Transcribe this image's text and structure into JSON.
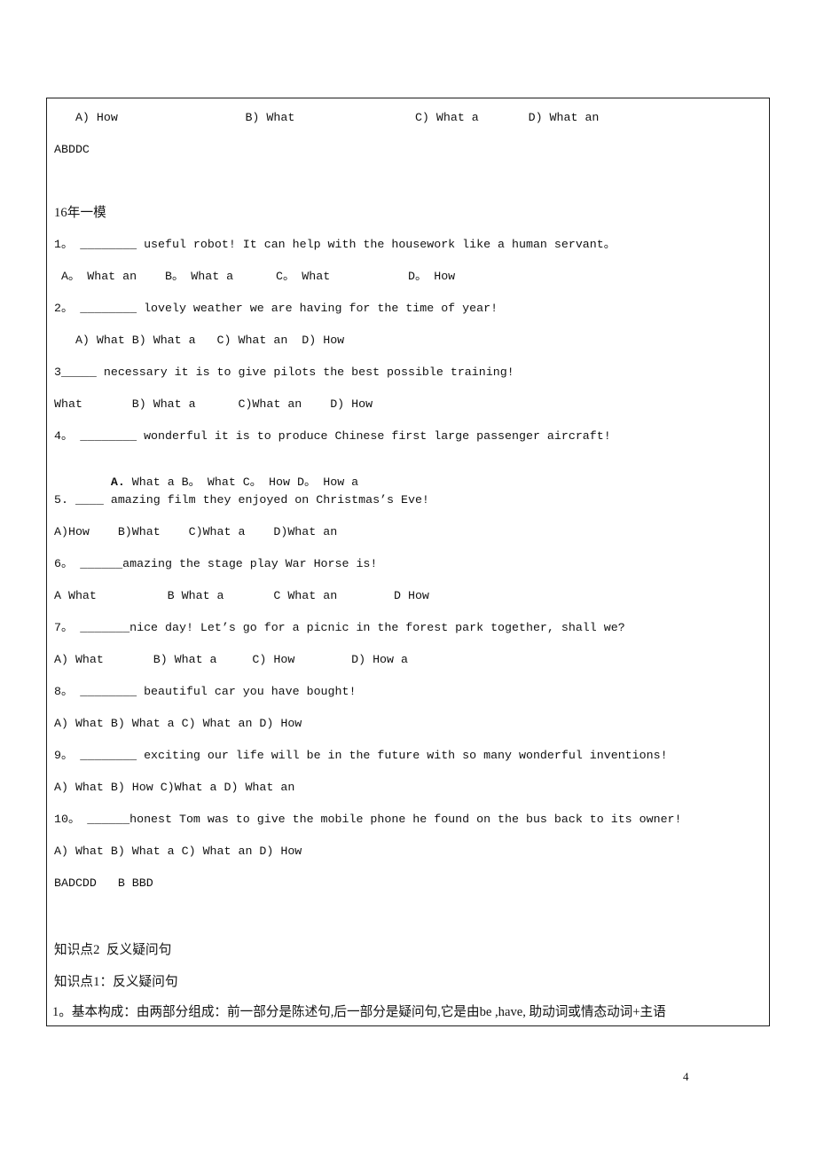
{
  "document": {
    "page_number": "4",
    "border_color": "#1d1d1d"
  },
  "exercise_box": {
    "prev_question_options": "   A) How                  B) What                 C) What a       D) What an",
    "prev_answer_key": "ABDDC",
    "section_heading": "16年一模",
    "questions": [
      {
        "id": "q1",
        "stem": "1。 ________ useful robot! It can help with the housework like a human servant。",
        "options": " A。 What an    B。 What a      C。 What           D。 How"
      },
      {
        "id": "q2",
        "stem": "2。 ________ lovely weather we are having for the time of year!",
        "options": "   A) What B) What a   C) What an  D) How"
      },
      {
        "id": "q3",
        "stem": "3_____ necessary it is to give pilots the best possible training!",
        "options": "What       B) What a      C)What an    D) How"
      },
      {
        "id": "q4",
        "stem": "4。 ________ wonderful it is to produce Chinese first large passenger aircraft!",
        "options_bold_lead": "A.",
        "options": " What a B。 What C。 How D。 How a"
      },
      {
        "id": "q5",
        "stem": "5. ____ amazing film they enjoyed on Christmas’s Eve!",
        "options": "A)How    B)What    C)What a    D)What an"
      },
      {
        "id": "q6",
        "stem": "6。 ______amazing the stage play War Horse is!",
        "options": "A What          B What a       C What an        D How"
      },
      {
        "id": "q7",
        "stem": "7。 _______nice day! Let’s go for a picnic in the forest park together, shall we?",
        "options": "A) What       B) What a     C) How        D) How a"
      },
      {
        "id": "q8",
        "stem": "8。 ________ beautiful car you have bought!",
        "options": "A) What B) What a C) What an D) How"
      },
      {
        "id": "q9",
        "stem": "9。 ________ exciting our life will be in the future with so many wonderful inventions!",
        "options": "A) What B) How C)What a D) What an"
      },
      {
        "id": "q10",
        "stem": "10。 ______honest Tom was to give the mobile phone he found on the bus back to its owner!",
        "options": "A) What B) What a C) What an D) How"
      }
    ],
    "answer_key": "BADCDD   B BBD",
    "knowledge_point_2_title": "知识点2  反义疑问句",
    "knowledge_point_1_title": "知识点1：反义疑问句",
    "knowledge_point_1_body": "1。基本构成：由两部分组成：前一部分是陈述句,后一部分是疑问句,它是由be ,have, 助动词或情态动词+主语"
  }
}
